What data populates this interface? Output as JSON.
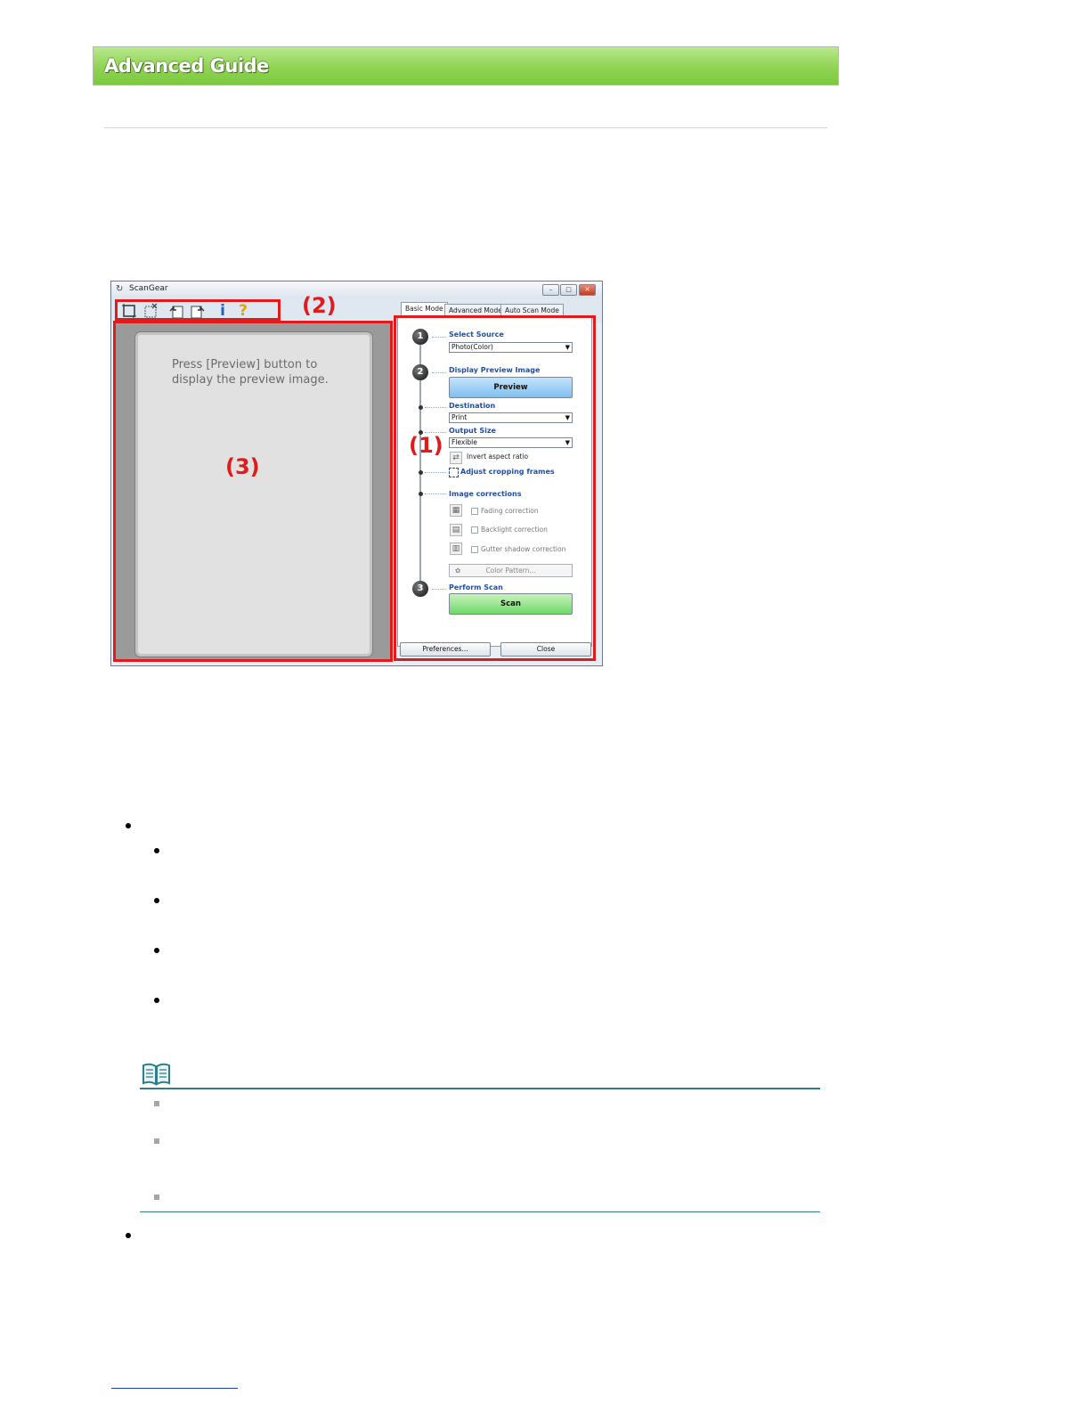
{
  "header": {
    "title": "Advanced Guide"
  },
  "window": {
    "title": "ScanGear",
    "controls": {
      "minimize": "–",
      "restore": "□",
      "close": "✕"
    },
    "toolbar_icons": [
      "crop-icon",
      "clear-crop-icon",
      "rotate-left-icon",
      "rotate-right-icon",
      "info-icon",
      "help-icon"
    ],
    "toolbar": {
      "info_glyph": "i",
      "help_glyph": "?"
    },
    "preview_area": {
      "message": "Press [Preview] button to display the preview image."
    },
    "tabs": [
      "Basic Mode",
      "Advanced Mode",
      "Auto Scan Mode"
    ],
    "steps": {
      "one": "1",
      "two": "2",
      "three": "3"
    },
    "select_source": {
      "label": "Select Source",
      "value": "Photo(Color)"
    },
    "display_preview": {
      "label": "Display Preview Image",
      "button": "Preview"
    },
    "destination": {
      "label": "Destination",
      "value": "Print"
    },
    "output_size": {
      "label": "Output Size",
      "value": "Flexible",
      "invert": "Invert aspect ratio"
    },
    "adjust_cropping": {
      "label": "Adjust cropping frames"
    },
    "image_corrections": {
      "label": "Image corrections",
      "options": [
        "Fading correction",
        "Backlight correction",
        "Gutter shadow correction"
      ],
      "color_pattern": "Color Pattern..."
    },
    "perform_scan": {
      "label": "Perform Scan",
      "button": "Scan"
    },
    "footer": {
      "preferences": "Preferences...",
      "close": "Close"
    }
  },
  "callouts": {
    "one": "(1)",
    "two": "(2)",
    "three": "(3)"
  }
}
